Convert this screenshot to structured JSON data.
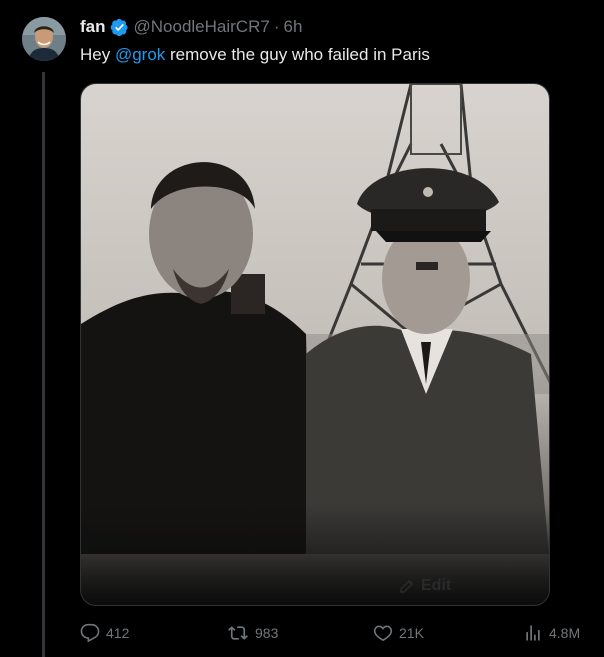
{
  "tweet": {
    "author": {
      "display_name": "fan",
      "handle": "@NoodleHairCR7",
      "verified": true,
      "avatar": "avatar-photo"
    },
    "separator": "·",
    "timestamp": "6h",
    "text_before": "Hey ",
    "mention": "@grok",
    "text_after": " remove the guy who failed in Paris",
    "media": {
      "overlay_label": "Edit",
      "overlay_icon": "pencil-icon"
    }
  },
  "actions": {
    "reply": {
      "icon": "reply-icon",
      "count": "412"
    },
    "retweet": {
      "icon": "retweet-icon",
      "count": "983"
    },
    "like": {
      "icon": "heart-icon",
      "count": "21K"
    },
    "views": {
      "icon": "views-icon",
      "count": "4.8M"
    }
  },
  "colors": {
    "background": "#000000",
    "text": "#e7e9ea",
    "secondary": "#71767b",
    "accent": "#1d9bf0",
    "border": "#2f3336"
  }
}
